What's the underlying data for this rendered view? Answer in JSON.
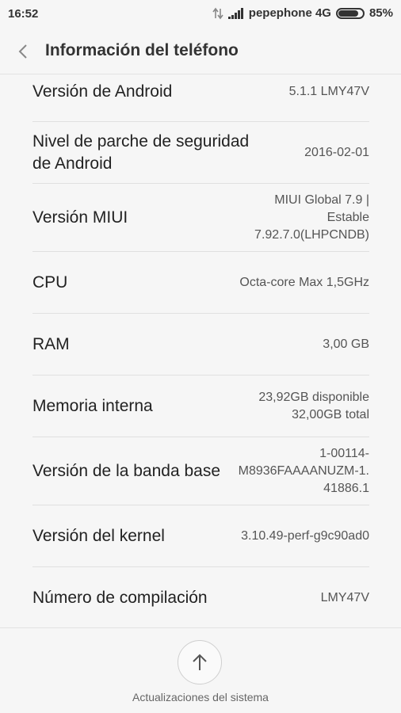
{
  "status_bar": {
    "time": "16:52",
    "carrier": "pepephone 4G",
    "battery_percent": "85%",
    "battery_level": 0.85
  },
  "header": {
    "title": "Información del teléfono"
  },
  "items": [
    {
      "label": "Versión de Android",
      "value": "5.1.1 LMY47V"
    },
    {
      "label": "Nivel de parche de seguridad de Android",
      "value": "2016-02-01"
    },
    {
      "label": "Versión MIUI",
      "value": "MIUI Global 7.9 |\nEstable\n7.92.7.0(LHPCNDB)"
    },
    {
      "label": "CPU",
      "value": "Octa-core Max 1,5GHz"
    },
    {
      "label": "RAM",
      "value": "3,00 GB"
    },
    {
      "label": "Memoria interna",
      "value": "23,92GB disponible\n32,00GB total"
    },
    {
      "label": "Versión de la banda base",
      "value": "1-00114-\nM8936FAAAANUZM-1.\n41886.1"
    },
    {
      "label": "Versión del kernel",
      "value": "3.10.49-perf-g9c90ad0"
    },
    {
      "label": "Número de compilación",
      "value": "LMY47V"
    }
  ],
  "footer": {
    "update_label": "Actualizaciones del sistema",
    "update_icon": "arrow-up-icon"
  }
}
